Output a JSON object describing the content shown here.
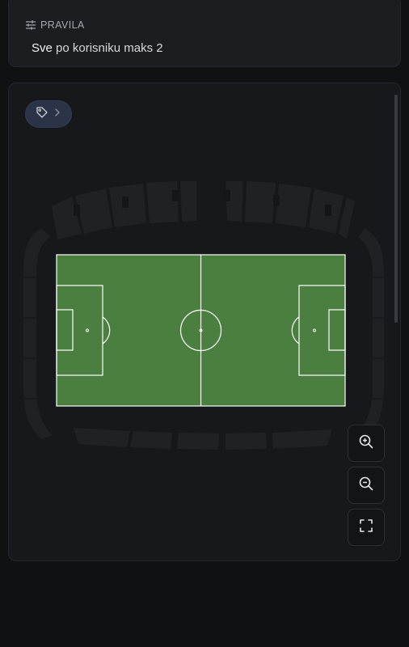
{
  "rules": {
    "title": "PRAVILA",
    "line_strong": "Sve",
    "line_rest": " po korisniku maks 2",
    "icon": "sliders-icon"
  },
  "map": {
    "tag_icon": "tag-icon",
    "chevron_icon": "chevron-right-icon",
    "controls": [
      "zoom-in-icon",
      "zoom-out-icon",
      "fullscreen-icon"
    ]
  },
  "colors": {
    "pitch": "#4a7f3f",
    "seats": "#26272b",
    "chip": "#2b3346"
  }
}
